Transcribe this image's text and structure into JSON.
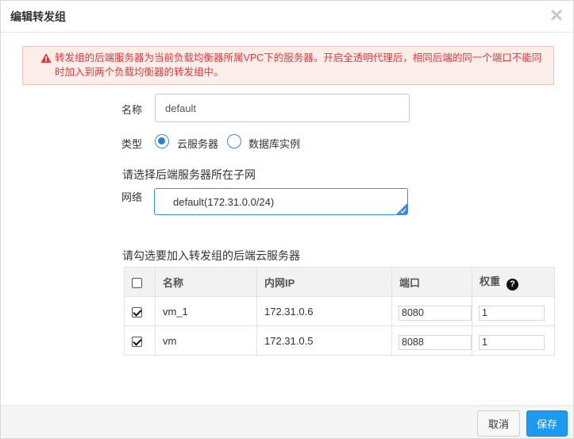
{
  "dialog": {
    "title": "编辑转发组",
    "close_icon": "close-icon"
  },
  "warning": {
    "icon": "warning-triangle-icon",
    "color": "#e4393c",
    "text": "转发组的后端服务器为当前负载均衡器所属VPC下的服务器。开启全透明代理后，相同后端的同一个端口不能同时加入到两个负载均衡器的转发组中。"
  },
  "form": {
    "name_label": "名称",
    "name_value": "default",
    "type_label": "类型",
    "type_options": [
      {
        "label": "云服务器",
        "checked": true
      },
      {
        "label": "数据库实例",
        "checked": false
      }
    ],
    "subnet_section": "请选择后端服务器所在子网",
    "network_label": "网络",
    "network_value": "default(172.31.0.0/24)"
  },
  "servers": {
    "section_title": "请勾选要加入转发组的后端云服务器",
    "headers": {
      "name": "名称",
      "ip": "内网IP",
      "port": "端口",
      "weight": "权重"
    },
    "header_checked": false,
    "rows": [
      {
        "checked": true,
        "name": "vm_1",
        "ip": "172.31.0.6",
        "port": "8080",
        "weight": "1"
      },
      {
        "checked": true,
        "name": "vm",
        "ip": "172.31.0.5",
        "port": "8088",
        "weight": "1"
      }
    ]
  },
  "footer": {
    "cancel_label": "取消",
    "save_label": "保存",
    "accent_color": "#1a9bf0"
  }
}
